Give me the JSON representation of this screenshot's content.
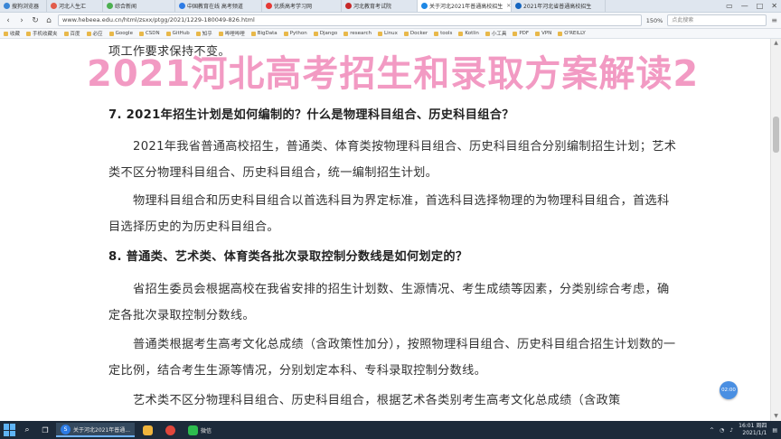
{
  "tabs": [
    {
      "label": "搜狗浏览器",
      "color": "#3a86d6",
      "active": false
    },
    {
      "label": "河北人生汇",
      "color": "#e25c4b",
      "active": false
    },
    {
      "label": "综合新闻",
      "color": "#4caf50",
      "active": false
    },
    {
      "label": "中国教育在线 高考频道",
      "color": "#2d7be5",
      "active": false
    },
    {
      "label": "优质高考学习网",
      "color": "#e53935",
      "active": false
    },
    {
      "label": "河北教育考试院",
      "color": "#c62828",
      "active": false
    },
    {
      "label": "关于河北2021年普通高校招生",
      "color": "#1e88e5",
      "active": true
    },
    {
      "label": "2021年河北省普通高校招生",
      "color": "#1565c0",
      "active": false
    }
  ],
  "window_controls": [
    "▭",
    "—",
    "□",
    "✕"
  ],
  "addressbar": {
    "back": "‹",
    "forward": "›",
    "refresh": "↻",
    "home": "⌂",
    "url": "www.hebeea.edu.cn/html/zsxx/ptgg/2021/1229-180049-826.html",
    "zoom": "150%",
    "search_placeholder": "点此搜索"
  },
  "bookmarks": [
    "收藏",
    "手机收藏夹",
    "百度",
    "必应",
    "Google",
    "CSDN",
    "GitHub",
    "知乎",
    "哔哩哔哩",
    "BigData",
    "Python",
    "Django",
    "research",
    "Linux",
    "Docker",
    "tools",
    "Kotlin",
    "小工具",
    "PDF",
    "VPN",
    "O'REILLY"
  ],
  "article": {
    "line_top": "项工作要求保持不变。",
    "q7_heading": "7. 2021年招生计划是如何编制的？什么是物理科目组合、历史科目组合？",
    "p1": "2021年我省普通高校招生，普通类、体育类按物理科目组合、历史科目组合分别编制招生计划；艺术类不区分物理科目组合、历史科目组合，统一编制招生计划。",
    "p2": "物理科目组合和历史科目组合以首选科目为界定标准，首选科目选择物理的为物理科目组合，首选科目选择历史的为历史科目组合。",
    "q8_heading": "8. 普通类、艺术类、体育类各批次录取控制分数线是如何划定的？",
    "p3": "省招生委员会根据高校在我省安排的招生计划数、生源情况、考生成绩等因素，分类别综合考虑，确定各批次录取控制分数线。",
    "p4": "普通类根据考生高考文化总成绩（含政策性加分），按照物理科目组合、历史科目组合招生计划数的一定比例，结合考生生源等情况，分别划定本科、专科录取控制分数线。",
    "p5": "艺术类不区分物理科目组合、历史科目组合，根据艺术各类别考生高考文化总成绩（含政策"
  },
  "overlay_title": "2021河北高考招生和录取方案解读2",
  "scroll": {
    "up": "▲",
    "down": "▼"
  },
  "float_button": "02:00",
  "taskbar": {
    "items": [
      {
        "label": "关于河北2021年普通...",
        "active": true
      },
      {
        "label": "",
        "active": false
      },
      {
        "label": "",
        "active": false
      },
      {
        "label": "微信",
        "active": false
      }
    ],
    "time": "16:01 周四",
    "date": "2021/1/1"
  }
}
